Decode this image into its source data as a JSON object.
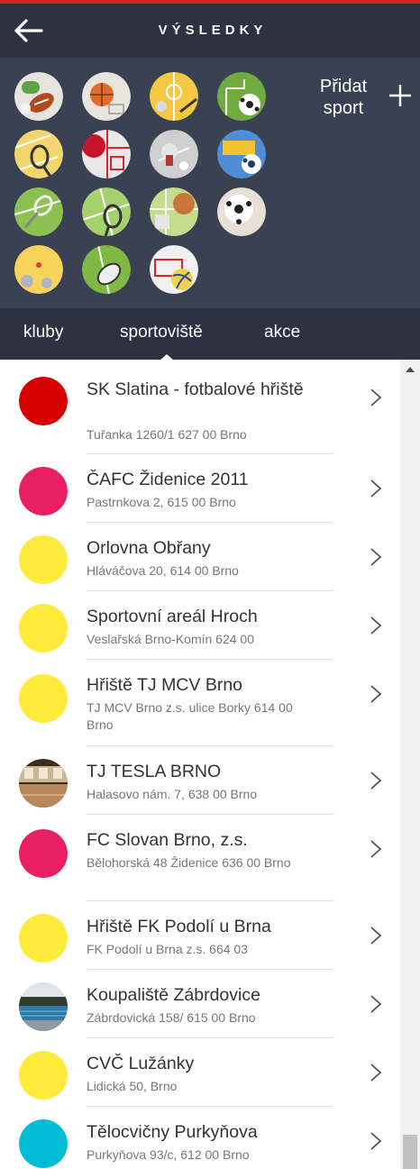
{
  "header": {
    "title": "VÝSLEDKY"
  },
  "sports": {
    "items": [
      "american-football",
      "basketball",
      "floorball",
      "football-field",
      "tennis-court",
      "boxing",
      "table-tennis",
      "goal-football",
      "badminton",
      "volleyball-court",
      "multi-sport",
      "soccer-ball",
      "petanque",
      "rugby",
      "volleyball"
    ],
    "add_label": "Přidat sport"
  },
  "tabs": [
    {
      "label": "kluby"
    },
    {
      "label": "sportoviště"
    },
    {
      "label": "akce"
    }
  ],
  "venues": [
    {
      "name": "SK Slatina - fotbalové hřiště",
      "address": "Tuřanka 1260/1 627 00 Brno",
      "color": "#d60000",
      "thumb": "none"
    },
    {
      "name": "ČAFC Židenice 2011",
      "address": "Pastrnkova 2, 615 00 Brno",
      "color": "#e91e63",
      "thumb": "none"
    },
    {
      "name": "Orlovna Obřany",
      "address": "Hláváčova 20, 614 00 Brno",
      "color": "#ffeb3b",
      "thumb": "none"
    },
    {
      "name": "Sportovní areál Hroch",
      "address": "Veslařská Brno-Komín 624 00",
      "color": "#ffeb3b",
      "thumb": "none"
    },
    {
      "name": "Hřiště TJ MCV Brno",
      "address": "TJ MCV Brno z.s. ulice Borky 614 00 Brno",
      "color": "#ffeb3b",
      "thumb": "none"
    },
    {
      "name": "TJ TESLA BRNO",
      "address": "Halasovo nám. 7, 638 00 Brno",
      "color": "#8d6e4e",
      "thumb": "gym-photo"
    },
    {
      "name": "FC Slovan Brno, z.s.",
      "address": "Bělohorská 48 Židenice 636 00 Brno",
      "color": "#e91e63",
      "thumb": "none"
    },
    {
      "name": "Hřiště FK Podolí u Brna",
      "address": "FK Podolí u Brna z.s. 664 03",
      "color": "#ffeb3b",
      "thumb": "none"
    },
    {
      "name": "Koupaliště Zábrdovice",
      "address": "Zábrdovická 158/ 615 00 Brno",
      "color": "#2f6f9a",
      "thumb": "pool-photo"
    },
    {
      "name": "CVČ Lužánky",
      "address": "Lidická 50, Brno",
      "color": "#ffeb3b",
      "thumb": "none"
    },
    {
      "name": "Tělocvičny Purkyňova",
      "address": "Purkyňova 93/c, 612 00 Brno",
      "color": "#00bcd4",
      "thumb": "none"
    }
  ],
  "colors": {
    "header_bg": "#2d3140",
    "sports_bg": "#3a4153",
    "accent_red": "#d8232a"
  }
}
